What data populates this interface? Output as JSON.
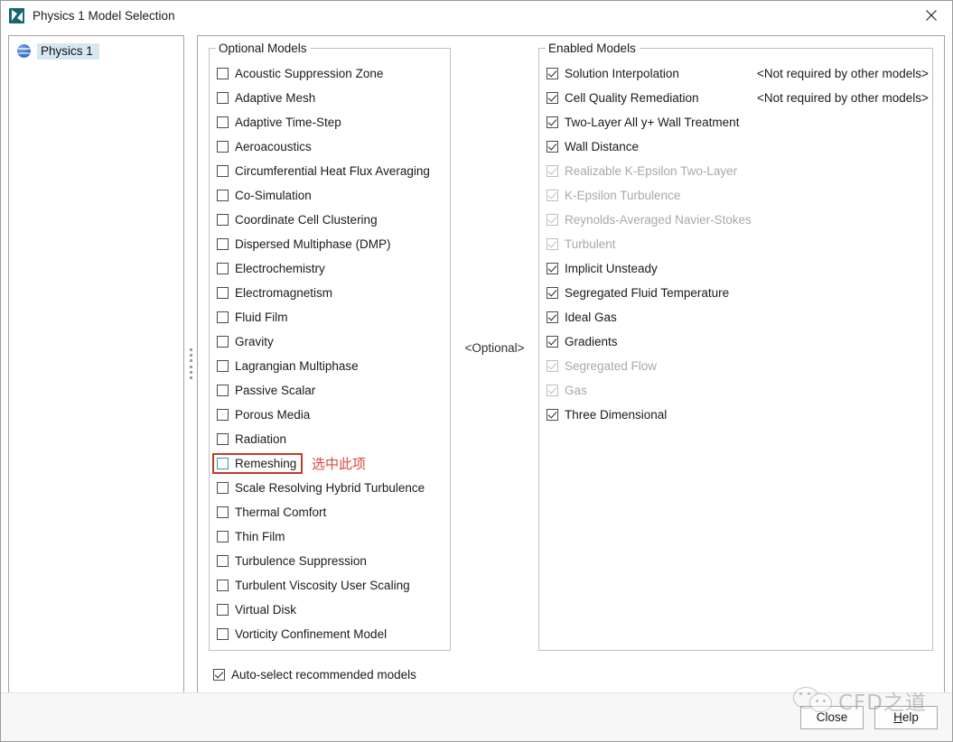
{
  "window": {
    "title": "Physics 1 Model Selection",
    "app_icon": "star-ccm-icon",
    "close_icon": "close-icon"
  },
  "tree": {
    "items": [
      {
        "label": "Physics 1",
        "icon": "physics-globe-icon",
        "selected": true
      }
    ]
  },
  "optional_group": {
    "legend": "Optional Models",
    "items": [
      {
        "label": "Acoustic Suppression Zone",
        "checked": false
      },
      {
        "label": "Adaptive Mesh",
        "checked": false
      },
      {
        "label": "Adaptive Time-Step",
        "checked": false
      },
      {
        "label": "Aeroacoustics",
        "checked": false
      },
      {
        "label": "Circumferential Heat Flux Averaging",
        "checked": false
      },
      {
        "label": "Co-Simulation",
        "checked": false
      },
      {
        "label": "Coordinate Cell Clustering",
        "checked": false
      },
      {
        "label": "Dispersed Multiphase (DMP)",
        "checked": false
      },
      {
        "label": "Electrochemistry",
        "checked": false
      },
      {
        "label": "Electromagnetism",
        "checked": false
      },
      {
        "label": "Fluid Film",
        "checked": false
      },
      {
        "label": "Gravity",
        "checked": false
      },
      {
        "label": "Lagrangian Multiphase",
        "checked": false
      },
      {
        "label": "Passive Scalar",
        "checked": false
      },
      {
        "label": "Porous Media",
        "checked": false
      },
      {
        "label": "Radiation",
        "checked": false
      },
      {
        "label": "Remeshing",
        "checked": false,
        "highlighted": true
      },
      {
        "label": "Scale Resolving Hybrid Turbulence",
        "checked": false
      },
      {
        "label": "Thermal Comfort",
        "checked": false
      },
      {
        "label": "Thin Film",
        "checked": false
      },
      {
        "label": "Turbulence Suppression",
        "checked": false
      },
      {
        "label": "Turbulent Viscosity User Scaling",
        "checked": false
      },
      {
        "label": "Virtual Disk",
        "checked": false
      },
      {
        "label": "Vorticity Confinement Model",
        "checked": false
      }
    ]
  },
  "middle": {
    "optional_tag": "<Optional>"
  },
  "enabled_group": {
    "legend": "Enabled Models",
    "items": [
      {
        "label": "Solution Interpolation",
        "checked": true,
        "disabled": false,
        "note": "<Not required by other models>"
      },
      {
        "label": "Cell Quality Remediation",
        "checked": true,
        "disabled": false,
        "note": "<Not required by other models>"
      },
      {
        "label": "Two-Layer All y+ Wall Treatment",
        "checked": true,
        "disabled": false,
        "note": ""
      },
      {
        "label": "Wall Distance",
        "checked": true,
        "disabled": false,
        "note": ""
      },
      {
        "label": "Realizable K-Epsilon Two-Layer",
        "checked": true,
        "disabled": true,
        "note": ""
      },
      {
        "label": "K-Epsilon Turbulence",
        "checked": true,
        "disabled": true,
        "note": ""
      },
      {
        "label": "Reynolds-Averaged Navier-Stokes",
        "checked": true,
        "disabled": true,
        "note": ""
      },
      {
        "label": "Turbulent",
        "checked": true,
        "disabled": true,
        "note": ""
      },
      {
        "label": "Implicit Unsteady",
        "checked": true,
        "disabled": false,
        "note": ""
      },
      {
        "label": "Segregated Fluid Temperature",
        "checked": true,
        "disabled": false,
        "note": ""
      },
      {
        "label": "Ideal Gas",
        "checked": true,
        "disabled": false,
        "note": ""
      },
      {
        "label": "Gradients",
        "checked": true,
        "disabled": false,
        "note": ""
      },
      {
        "label": "Segregated Flow",
        "checked": true,
        "disabled": true,
        "note": ""
      },
      {
        "label": "Gas",
        "checked": true,
        "disabled": true,
        "note": ""
      },
      {
        "label": "Three Dimensional",
        "checked": true,
        "disabled": false,
        "note": ""
      }
    ]
  },
  "autoselect": {
    "label": "Auto-select recommended models",
    "checked": true
  },
  "buttons": {
    "close": "Close",
    "help_prefix": "H",
    "help_rest": "elp"
  },
  "annotation": {
    "text": "选中此项",
    "color": "#e0463b",
    "target": "Remeshing"
  },
  "watermark": {
    "text": "CFD之道",
    "logo": "wechat-logo"
  },
  "colors": {
    "accent_teal": "#2f9aa3",
    "annotation_red": "#c0392b",
    "selection_blue": "#d6e7f2",
    "disabled_gray": "#a8a8a8"
  }
}
